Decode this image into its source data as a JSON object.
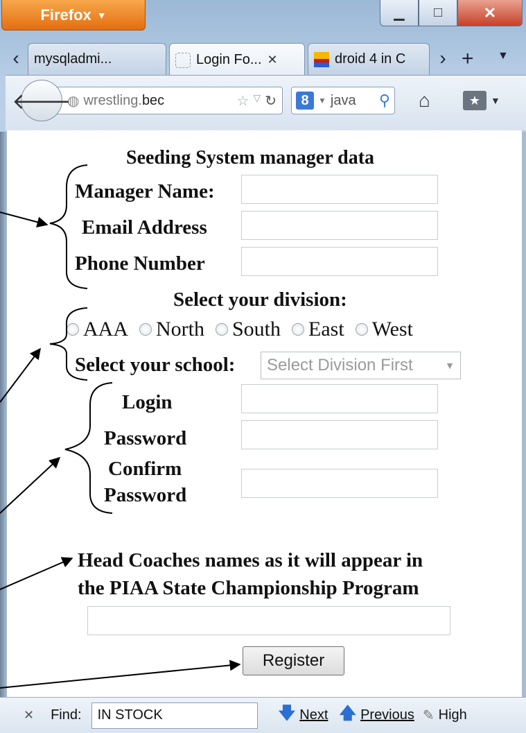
{
  "browser": {
    "menu_label": "Firefox",
    "tabs": [
      {
        "label": "mysqladmi..."
      },
      {
        "label": "Login Fo..."
      },
      {
        "label": "droid 4 in C"
      }
    ],
    "url_prefix": "wrestling.",
    "url_domain": "bec",
    "search_text": "java",
    "icons": {
      "back": "back-arrow-icon",
      "globe": "globe-icon",
      "star": "star-icon",
      "reload": "reload-icon",
      "search_engine": "google-icon",
      "search": "magnifier-icon",
      "home": "home-icon",
      "bookmarks": "bookmarks-icon"
    }
  },
  "form": {
    "heading": "Seeding System manager data",
    "manager_name_label": "Manager Name:",
    "email_label": "Email Address",
    "phone_label": "Phone Number",
    "division_heading": "Select your division:",
    "divisions": [
      "AAA",
      "North",
      "South",
      "East",
      "West"
    ],
    "school_label": "Select your school:",
    "school_select_value": "Select Division First",
    "login_label": "Login",
    "password_label": "Password",
    "confirm_label_1": "Confirm",
    "confirm_label_2": "Password",
    "coach_heading_1": "Head Coaches names as it will appear in",
    "coach_heading_2": "the PIAA State Championship Program",
    "register_label": "Register"
  },
  "find_bar": {
    "label": "Find:",
    "value": "IN STOCK",
    "next_label": "Next",
    "previous_label": "Previous",
    "highlight_label": "High"
  }
}
